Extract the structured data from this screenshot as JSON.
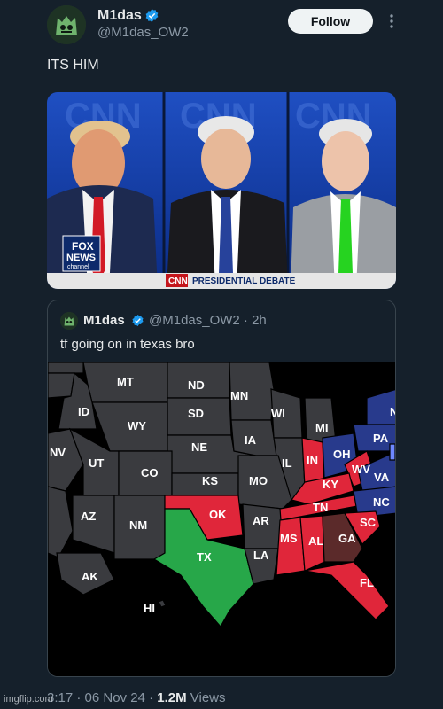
{
  "tweet": {
    "display_name": "M1das",
    "handle": "@M1das_OW2",
    "follow_label": "Follow",
    "text": "ITS HIM",
    "timestamp": "3:17 · 06 Nov 24 · ",
    "views_count": "1.2M",
    "views_label": " Views"
  },
  "debate_image": {
    "network_logo": "CNN",
    "chyron": "PRESIDENTIAL DEBATE",
    "fox_logo_line1": "FOX",
    "fox_logo_line2": "NEWS",
    "fox_logo_line3": "channel"
  },
  "quoted_tweet": {
    "display_name": "M1das",
    "handle_time": "@M1das_OW2 · 2h",
    "text": "tf going on in texas bro"
  },
  "map": {
    "states": {
      "MT": "MT",
      "ND": "ND",
      "MN": "MN",
      "ID": "ID",
      "SD": "SD",
      "WI": "WI",
      "MI": "MI",
      "WY": "WY",
      "IA": "IA",
      "NE": "NE",
      "PA": "PA",
      "NV": "NV",
      "UT": "UT",
      "IL": "IL",
      "IN": "IN",
      "OH": "OH",
      "WV": "WV",
      "VA": "VA",
      "CO": "CO",
      "KS": "KS",
      "MO": "MO",
      "KY": "KY",
      "NC": "NC",
      "TN": "TN",
      "AZ": "AZ",
      "OK": "OK",
      "NM": "NM",
      "AR": "AR",
      "SC": "SC",
      "MS": "MS",
      "AL": "AL",
      "GA": "GA",
      "TX": "TX",
      "LA": "LA",
      "FL": "FL",
      "AK": "AK",
      "HI": "HI",
      "N": "N"
    },
    "colors": {
      "gray": "#3a3b3f",
      "red": "#e0263a",
      "blue": "#283a8c",
      "green": "#27a749",
      "ga_brown": "#5b2a2a"
    }
  },
  "icons": {
    "verified": "verified-badge-icon",
    "more": "more-icon"
  },
  "watermark": "imgflip.com"
}
